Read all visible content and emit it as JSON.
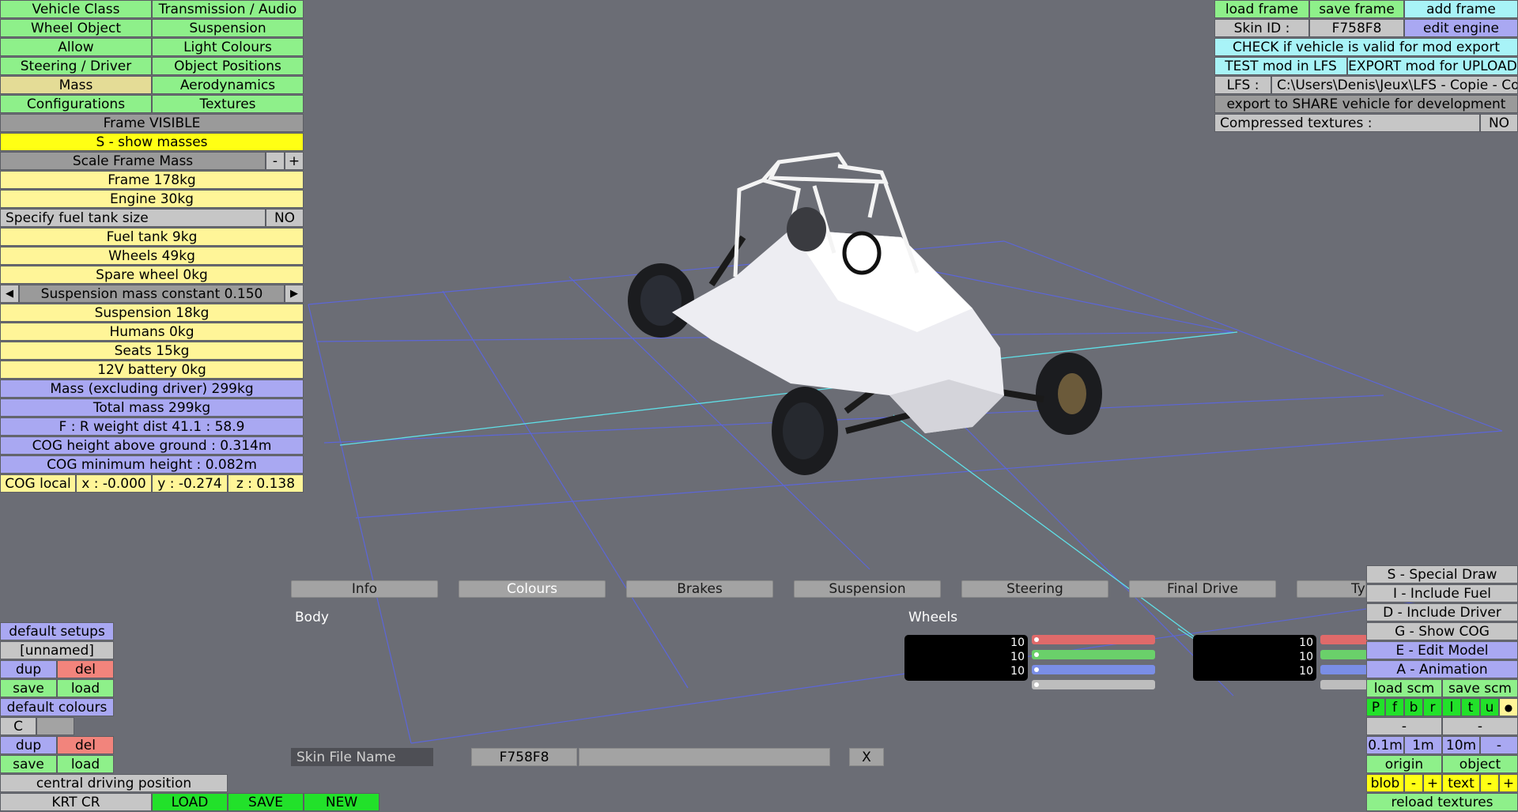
{
  "left_menu": {
    "tabs": [
      [
        "Vehicle Class",
        "Transmission / Audio"
      ],
      [
        "Wheel Object",
        "Suspension"
      ],
      [
        "Allow",
        "Light Colours"
      ],
      [
        "Steering / Driver",
        "Object Positions"
      ],
      [
        "Mass",
        "Aerodynamics"
      ],
      [
        "Configurations",
        "Textures"
      ]
    ],
    "frame_visible": "Frame VISIBLE",
    "show_masses": "S - show masses",
    "scale_frame_mass": "Scale Frame Mass",
    "minus": "-",
    "plus": "+",
    "frame": "Frame 178kg",
    "engine": "Engine 30kg",
    "fuel_tank_label": "Specify fuel tank size",
    "fuel_tank_value": "NO",
    "fuel_tank": "Fuel tank 9kg",
    "wheels": "Wheels 49kg",
    "spare_wheel": "Spare wheel 0kg",
    "suspension_mass": "Suspension mass constant 0.150",
    "arrow_left": "◀",
    "arrow_right": "▶",
    "suspension": "Suspension 18kg",
    "humans": "Humans 0kg",
    "seats": "Seats 15kg",
    "battery": "12V battery 0kg",
    "mass_excl": "Mass (excluding driver) 299kg",
    "total_mass": "Total mass 299kg",
    "weight_dist": "F : R  weight dist  41.1 : 58.9",
    "cog_height": "COG height above ground : 0.314m",
    "cog_min": "COG minimum height : 0.082m",
    "cog_local": "COG local",
    "cog_x": "x : -0.000",
    "cog_y": "y : -0.274",
    "cog_z": "z : 0.138"
  },
  "top_right": {
    "load_frame": "load frame",
    "save_frame": "save frame",
    "add_frame": "add frame",
    "skin_id_label": "Skin ID :",
    "skin_id_value": "F758F8",
    "edit_engine": "edit engine",
    "check_valid": "CHECK if vehicle is valid for mod export",
    "test_mod": "TEST mod in LFS",
    "export_mod": "EXPORT mod for UPLOAD",
    "lfs_label": "LFS :",
    "lfs_path": "C:\\Users\\Denis\\Jeux\\LFS - Copie - Copie",
    "export_share": "export to SHARE vehicle for development",
    "compressed_label": "Compressed textures :",
    "compressed_value": "NO"
  },
  "bottom_tabs": [
    "Info",
    "Colours",
    "Brakes",
    "Suspension",
    "Steering",
    "Final Drive",
    "Ty"
  ],
  "colours_panel": {
    "body_label": "Body",
    "wheels_label": "Wheels",
    "values": [
      "10",
      "10",
      "10"
    ],
    "skin_file_label": "Skin File Name",
    "skin_file_value": "F758F8",
    "clear": "X"
  },
  "bottom_left": {
    "default_setups": "default setups",
    "unnamed": "[unnamed]",
    "dup": "dup",
    "del": "del",
    "save": "save",
    "load": "load",
    "default_colours": "default colours",
    "c": "C",
    "central_driving": "central driving position",
    "car_name": "KRT CR",
    "load_btn": "LOAD",
    "save_btn": "SAVE",
    "new_btn": "NEW"
  },
  "bottom_right": {
    "special_draw": "S - Special Draw",
    "include_fuel": "I - Include Fuel",
    "include_driver": "D - Include Driver",
    "show_cog": "G - Show COG",
    "edit_model": "E - Edit Model",
    "animation": "A - Animation",
    "load_scm": "load scm",
    "save_scm": "save scm",
    "view_letters": [
      "P",
      "f",
      "b",
      "r",
      "l",
      "t",
      "u"
    ],
    "dash": "-",
    "step_01": "0.1m",
    "step_1": "1m",
    "step_10": "10m",
    "origin": "origin",
    "object": "object",
    "blob": "blob",
    "text": "text",
    "reload_textures": "reload textures"
  },
  "colors": {
    "green": "#8ef08a",
    "yellow": "#fff598",
    "purple": "#a9a8f2",
    "red": "#f2847c",
    "cyan": "#a8f3f7",
    "bright_green": "#22e12a"
  }
}
